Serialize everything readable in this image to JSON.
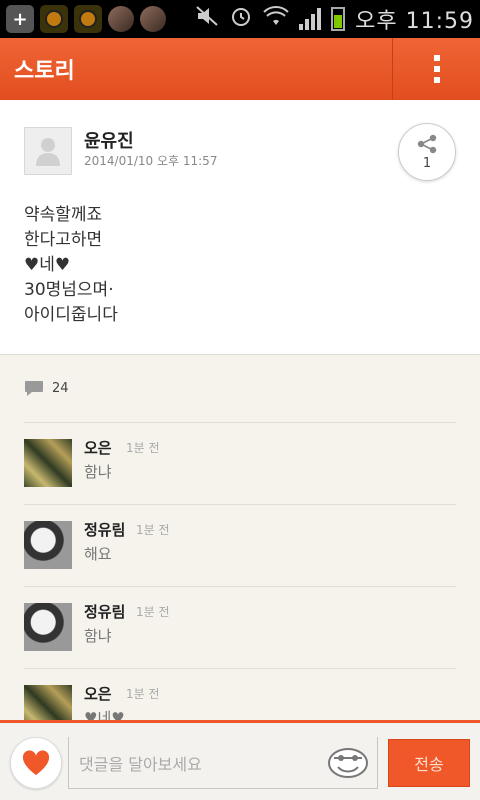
{
  "status_bar": {
    "time_label": "오후 11:59",
    "battery_color": "#7ec800"
  },
  "header": {
    "title": "스토리",
    "overflow_icon": "more-vert-icon",
    "color": "#f0582a"
  },
  "post": {
    "author": "윤유진",
    "date": "2014/01/10 오후 11:57",
    "share_count": "1",
    "body_lines": [
      "약속할께죠",
      "한다고하면",
      "♥네♥",
      "30명넘으며·",
      "아이디줍니다"
    ]
  },
  "comments": {
    "count": "24",
    "items": [
      {
        "name": "오은",
        "time": "1분 전",
        "text": "함냐"
      },
      {
        "name": "정유림",
        "time": "1분 전",
        "text": "해요"
      },
      {
        "name": "정유림",
        "time": "1분 전",
        "text": "함냐"
      },
      {
        "name": "오은",
        "time": "1분 전",
        "text": "♥네♥"
      }
    ]
  },
  "footer": {
    "placeholder": "댓글을 달아보세요",
    "send_label": "전송"
  }
}
